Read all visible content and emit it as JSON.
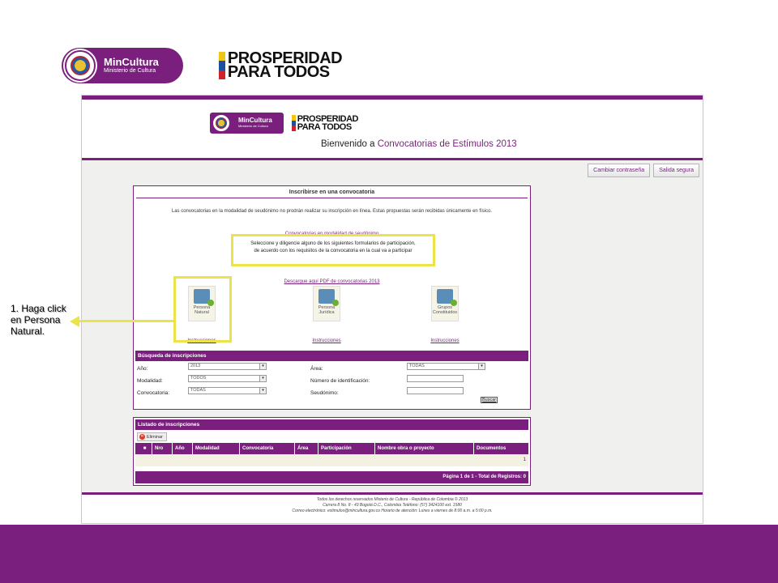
{
  "slide": {
    "logos": {
      "mincultura": {
        "name": "MinCultura",
        "sub": "Ministerio de Cultura"
      },
      "prosperidad": {
        "line1": "PROSPERIDAD",
        "line2": "PARA TODOS"
      }
    },
    "annotation": "1. Haga click en Persona Natural."
  },
  "screen": {
    "header": {
      "welcome_prefix": "Bienvenido a ",
      "welcome_highlight": "Convocatorias de Estímulos 2013"
    },
    "top_buttons": {
      "change_password": "Cambiar contraseña",
      "logout": "Salida segura"
    },
    "panel": {
      "title": "Inscribirse en una convocatoria",
      "intro": "Las convocatorias en la modalidad de seudónimo no prodrán realizar su inscripción en línea. Estas propuestas serán recibidas únicamente en físico.",
      "link_seudonimo": "Convocatorias en modalidad de seudónimo",
      "notice_line1": "Seleccione y diligencie alguno de los siguientes formularios de participación,",
      "notice_line2": "de acuerdo con los requisitos de la convocatoria en la cual va a participar",
      "link_pdf": "Descargue aquí PDF de convocatorias 2013",
      "options": [
        {
          "label": "Persona Natural",
          "link": "Instrucciones"
        },
        {
          "label": "Persona Jurídica",
          "link": "Instrucciones"
        },
        {
          "label": "Grupos Constituidos",
          "link": "Instrucciones"
        }
      ]
    },
    "search": {
      "title": "Búsqueda de inscripciones",
      "year_label": "Año:",
      "year_value": "2013",
      "modality_label": "Modalidad:",
      "modality_value": "TODOS",
      "call_label": "Convocatoria:",
      "call_value": "TODAS",
      "area_label": "Área:",
      "area_value": "TODAS",
      "id_label": "Número de identificación:",
      "pseudonym_label": "Seudónimo:",
      "search_button": "Buscar"
    },
    "list": {
      "title": "Listado de inscripciones",
      "delete_button": "Eliminar",
      "columns": [
        "Nro",
        "Año",
        "Modalidad",
        "Convocatoria",
        "Área",
        "Participación",
        "Nombre obra o proyecto",
        "Documentos"
      ],
      "row_value": "1",
      "pager": "Página 1 de 1 - Total de Registros: 0"
    },
    "footer": {
      "line1": "Todos los derechos reservados Misterio de Cultura - República de Colombia © 2013",
      "line2": "Carrera 8 No. 8 - 43 Bogotá D.C., Colombia Teléfono: (57) 3424100 ext. 1580",
      "line3": "Correo electrónico: estimulos@mincultura.gov.co Horario de atención: Lunes a viernes de 8:00 a.m. a 5:00 p.m."
    }
  },
  "colors": {
    "brand_purple": "#7a1f7d",
    "highlight_yellow": "#ece34a"
  },
  "icons": {
    "seal": "colombia-seal-icon",
    "person": "person-natural-icon",
    "company": "persona-juridica-icon",
    "group": "grupos-icon",
    "delete": "delete-x-icon",
    "dropdown": "chevron-down-icon"
  }
}
